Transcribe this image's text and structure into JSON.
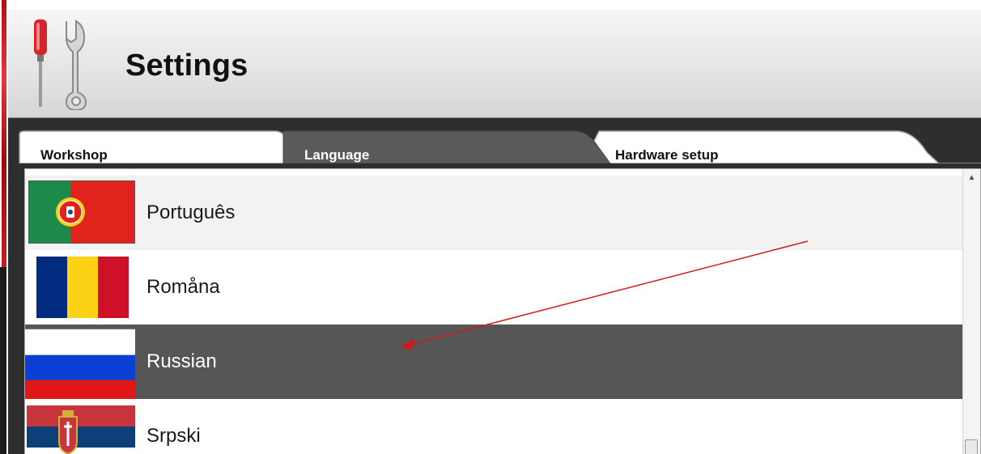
{
  "header": {
    "title": "Settings",
    "icon": "tools-icon"
  },
  "tabs": [
    {
      "label": "Workshop",
      "active": false
    },
    {
      "label": "Language",
      "active": true
    },
    {
      "label": "Hardware setup",
      "active": false
    }
  ],
  "languages": [
    {
      "label": "Português",
      "flag": "portugal-flag-icon",
      "selected": false
    },
    {
      "label": "Romåna",
      "flag": "romania-flag-icon",
      "selected": false
    },
    {
      "label": "Russian",
      "flag": "russia-flag-icon",
      "selected": true
    },
    {
      "label": "Srpski",
      "flag": "serbia-flag-icon",
      "selected": false
    }
  ],
  "colors": {
    "selected_row": "#565656",
    "annotation_arrow": "#d21a1a",
    "accent_red": "#d8232a"
  }
}
